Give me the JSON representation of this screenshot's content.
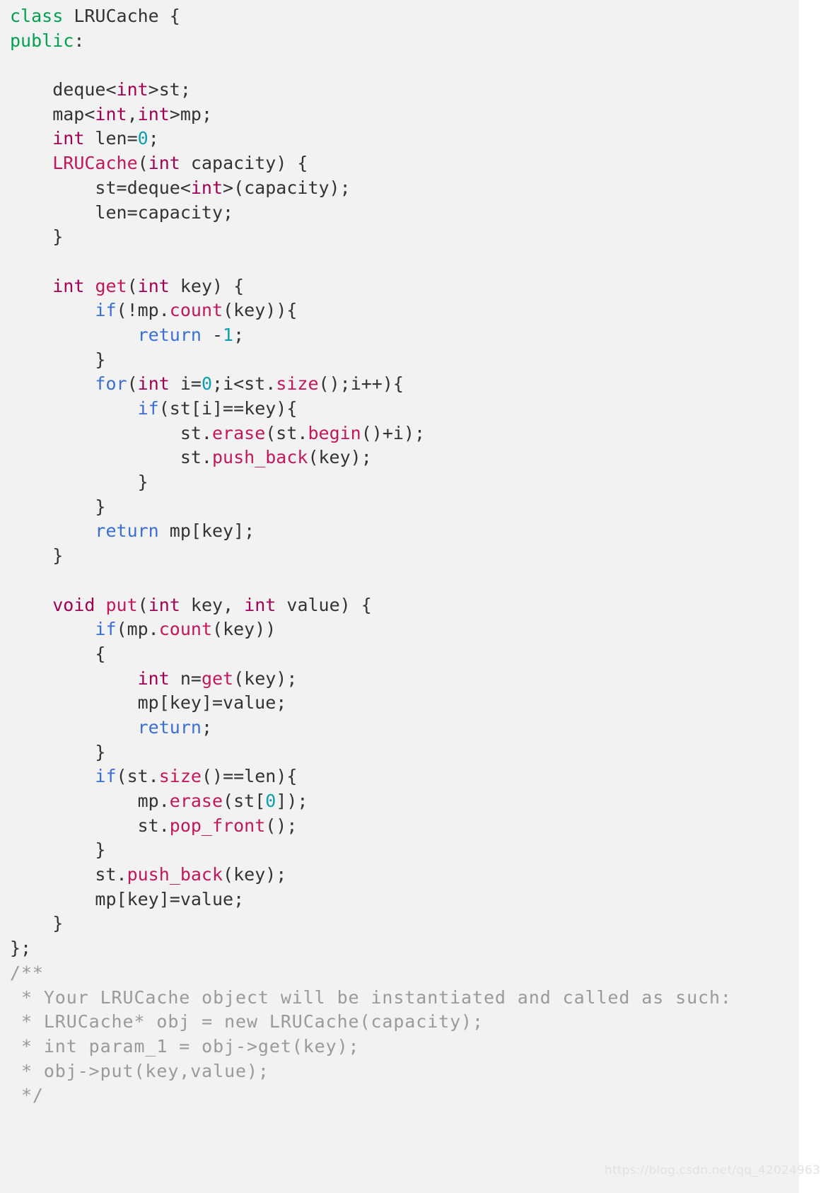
{
  "editor": {
    "language": "cpp",
    "background_color": "#f2f2f2",
    "page_background_color": "#ffffff",
    "default_text_color": "#333333",
    "theme_colors": {
      "keyword": "#00a050",
      "control": "#3b6fd4",
      "type": "#a00053",
      "function": "#c2185b",
      "number": "#0b9fb0",
      "comment": "#999999",
      "plain": "#333333"
    }
  },
  "code": {
    "lines": [
      [
        {
          "t": "class ",
          "c": "kw"
        },
        {
          "t": "LRUCache {",
          "c": "plain"
        }
      ],
      [
        {
          "t": "public",
          "c": "kw"
        },
        {
          "t": ":",
          "c": "plain"
        }
      ],
      [
        {
          "t": "",
          "c": "plain"
        }
      ],
      [
        {
          "t": "    deque<",
          "c": "plain"
        },
        {
          "t": "int",
          "c": "type"
        },
        {
          "t": ">st;",
          "c": "plain"
        }
      ],
      [
        {
          "t": "    map<",
          "c": "plain"
        },
        {
          "t": "int",
          "c": "type"
        },
        {
          "t": ",",
          "c": "plain"
        },
        {
          "t": "int",
          "c": "type"
        },
        {
          "t": ">mp;",
          "c": "plain"
        }
      ],
      [
        {
          "t": "    ",
          "c": "plain"
        },
        {
          "t": "int",
          "c": "type"
        },
        {
          "t": " len=",
          "c": "plain"
        },
        {
          "t": "0",
          "c": "num"
        },
        {
          "t": ";",
          "c": "plain"
        }
      ],
      [
        {
          "t": "    ",
          "c": "plain"
        },
        {
          "t": "LRUCache",
          "c": "fn"
        },
        {
          "t": "(",
          "c": "plain"
        },
        {
          "t": "int",
          "c": "type"
        },
        {
          "t": " capacity) {",
          "c": "plain"
        }
      ],
      [
        {
          "t": "        st=deque<",
          "c": "plain"
        },
        {
          "t": "int",
          "c": "type"
        },
        {
          "t": ">(capacity);",
          "c": "plain"
        }
      ],
      [
        {
          "t": "        len=capacity;",
          "c": "plain"
        }
      ],
      [
        {
          "t": "    }",
          "c": "plain"
        }
      ],
      [
        {
          "t": "",
          "c": "plain"
        }
      ],
      [
        {
          "t": "    ",
          "c": "plain"
        },
        {
          "t": "int",
          "c": "type"
        },
        {
          "t": " ",
          "c": "plain"
        },
        {
          "t": "get",
          "c": "fn"
        },
        {
          "t": "(",
          "c": "plain"
        },
        {
          "t": "int",
          "c": "type"
        },
        {
          "t": " key) {",
          "c": "plain"
        }
      ],
      [
        {
          "t": "        ",
          "c": "plain"
        },
        {
          "t": "if",
          "c": "ctrl"
        },
        {
          "t": "(!mp.",
          "c": "plain"
        },
        {
          "t": "count",
          "c": "fn"
        },
        {
          "t": "(key)){",
          "c": "plain"
        }
      ],
      [
        {
          "t": "            ",
          "c": "plain"
        },
        {
          "t": "return",
          "c": "ctrl"
        },
        {
          "t": " -",
          "c": "plain"
        },
        {
          "t": "1",
          "c": "num"
        },
        {
          "t": ";",
          "c": "plain"
        }
      ],
      [
        {
          "t": "        }",
          "c": "plain"
        }
      ],
      [
        {
          "t": "        ",
          "c": "plain"
        },
        {
          "t": "for",
          "c": "ctrl"
        },
        {
          "t": "(",
          "c": "plain"
        },
        {
          "t": "int",
          "c": "type"
        },
        {
          "t": " i=",
          "c": "plain"
        },
        {
          "t": "0",
          "c": "num"
        },
        {
          "t": ";i<st.",
          "c": "plain"
        },
        {
          "t": "size",
          "c": "fn"
        },
        {
          "t": "();i++){",
          "c": "plain"
        }
      ],
      [
        {
          "t": "            ",
          "c": "plain"
        },
        {
          "t": "if",
          "c": "ctrl"
        },
        {
          "t": "(st[i]==key){",
          "c": "plain"
        }
      ],
      [
        {
          "t": "                st.",
          "c": "plain"
        },
        {
          "t": "erase",
          "c": "fn"
        },
        {
          "t": "(st.",
          "c": "plain"
        },
        {
          "t": "begin",
          "c": "fn"
        },
        {
          "t": "()+i);",
          "c": "plain"
        }
      ],
      [
        {
          "t": "                st.",
          "c": "plain"
        },
        {
          "t": "push_back",
          "c": "fn"
        },
        {
          "t": "(key);",
          "c": "plain"
        }
      ],
      [
        {
          "t": "            }",
          "c": "plain"
        }
      ],
      [
        {
          "t": "        }",
          "c": "plain"
        }
      ],
      [
        {
          "t": "        ",
          "c": "plain"
        },
        {
          "t": "return",
          "c": "ctrl"
        },
        {
          "t": " mp[key];",
          "c": "plain"
        }
      ],
      [
        {
          "t": "    }",
          "c": "plain"
        }
      ],
      [
        {
          "t": "",
          "c": "plain"
        }
      ],
      [
        {
          "t": "    ",
          "c": "plain"
        },
        {
          "t": "void",
          "c": "type"
        },
        {
          "t": " ",
          "c": "plain"
        },
        {
          "t": "put",
          "c": "fn"
        },
        {
          "t": "(",
          "c": "plain"
        },
        {
          "t": "int",
          "c": "type"
        },
        {
          "t": " key, ",
          "c": "plain"
        },
        {
          "t": "int",
          "c": "type"
        },
        {
          "t": " value) {",
          "c": "plain"
        }
      ],
      [
        {
          "t": "        ",
          "c": "plain"
        },
        {
          "t": "if",
          "c": "ctrl"
        },
        {
          "t": "(mp.",
          "c": "plain"
        },
        {
          "t": "count",
          "c": "fn"
        },
        {
          "t": "(key))",
          "c": "plain"
        }
      ],
      [
        {
          "t": "        {",
          "c": "plain"
        }
      ],
      [
        {
          "t": "            ",
          "c": "plain"
        },
        {
          "t": "int",
          "c": "type"
        },
        {
          "t": " n=",
          "c": "plain"
        },
        {
          "t": "get",
          "c": "fn"
        },
        {
          "t": "(key);",
          "c": "plain"
        }
      ],
      [
        {
          "t": "            mp[key]=value;",
          "c": "plain"
        }
      ],
      [
        {
          "t": "            ",
          "c": "plain"
        },
        {
          "t": "return",
          "c": "ctrl"
        },
        {
          "t": ";",
          "c": "plain"
        }
      ],
      [
        {
          "t": "        }",
          "c": "plain"
        }
      ],
      [
        {
          "t": "        ",
          "c": "plain"
        },
        {
          "t": "if",
          "c": "ctrl"
        },
        {
          "t": "(st.",
          "c": "plain"
        },
        {
          "t": "size",
          "c": "fn"
        },
        {
          "t": "()==len){",
          "c": "plain"
        }
      ],
      [
        {
          "t": "            mp.",
          "c": "plain"
        },
        {
          "t": "erase",
          "c": "fn"
        },
        {
          "t": "(st[",
          "c": "plain"
        },
        {
          "t": "0",
          "c": "num"
        },
        {
          "t": "]);",
          "c": "plain"
        }
      ],
      [
        {
          "t": "            st.",
          "c": "plain"
        },
        {
          "t": "pop_front",
          "c": "fn"
        },
        {
          "t": "();",
          "c": "plain"
        }
      ],
      [
        {
          "t": "        }",
          "c": "plain"
        }
      ],
      [
        {
          "t": "        st.",
          "c": "plain"
        },
        {
          "t": "push_back",
          "c": "fn"
        },
        {
          "t": "(key);",
          "c": "plain"
        }
      ],
      [
        {
          "t": "        mp[key]=value;",
          "c": "plain"
        }
      ],
      [
        {
          "t": "    }",
          "c": "plain"
        }
      ],
      [
        {
          "t": "};",
          "c": "plain"
        }
      ]
    ],
    "comment_lines": [
      "/**",
      " * Your LRUCache object will be instantiated and called as such:",
      " * LRUCache* obj = new LRUCache(capacity);",
      " * int param_1 = obj->get(key);",
      " * obj->put(key,value);",
      " */"
    ]
  },
  "watermark": {
    "text": "https://blog.csdn.net/qq_42024963"
  }
}
